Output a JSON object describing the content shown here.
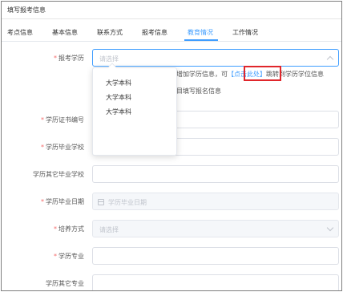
{
  "header": {
    "title": "填写报考信息"
  },
  "tabs": [
    {
      "label": "考点信息"
    },
    {
      "label": "基本信息"
    },
    {
      "label": "联系方式"
    },
    {
      "label": "报考信息"
    },
    {
      "label": "教育情况",
      "active": true
    },
    {
      "label": "工作情况"
    }
  ],
  "form": {
    "education_level": {
      "label": "报考学历",
      "required": true,
      "placeholder": "请选择"
    },
    "cert_no": {
      "label": "学历证书编号",
      "required": true
    },
    "school": {
      "label": "学历毕业学校",
      "required": true
    },
    "other_school": {
      "label": "学历其它毕业学校",
      "required": false
    },
    "grad_date": {
      "label": "学历毕业日期",
      "required": true,
      "placeholder": "学历毕业日期"
    },
    "training_mode": {
      "label": "培养方式",
      "required": true,
      "placeholder": "请选择"
    },
    "major": {
      "label": "学历专业",
      "required": true
    },
    "other_major": {
      "label": "学历其它专业",
      "required": false
    }
  },
  "notice": {
    "prefix": "如需增加学历信息，可",
    "link": "【点击此处】",
    "suffix": "跳转到学历学位信息",
    "line2": "试项目填写报名信息"
  },
  "dropdown": {
    "options": [
      "大学本科",
      "大学本科",
      "大学本科"
    ]
  },
  "colors": {
    "accent": "#409eff",
    "required": "#f56c6c",
    "highlight_box": "#e0262b"
  }
}
